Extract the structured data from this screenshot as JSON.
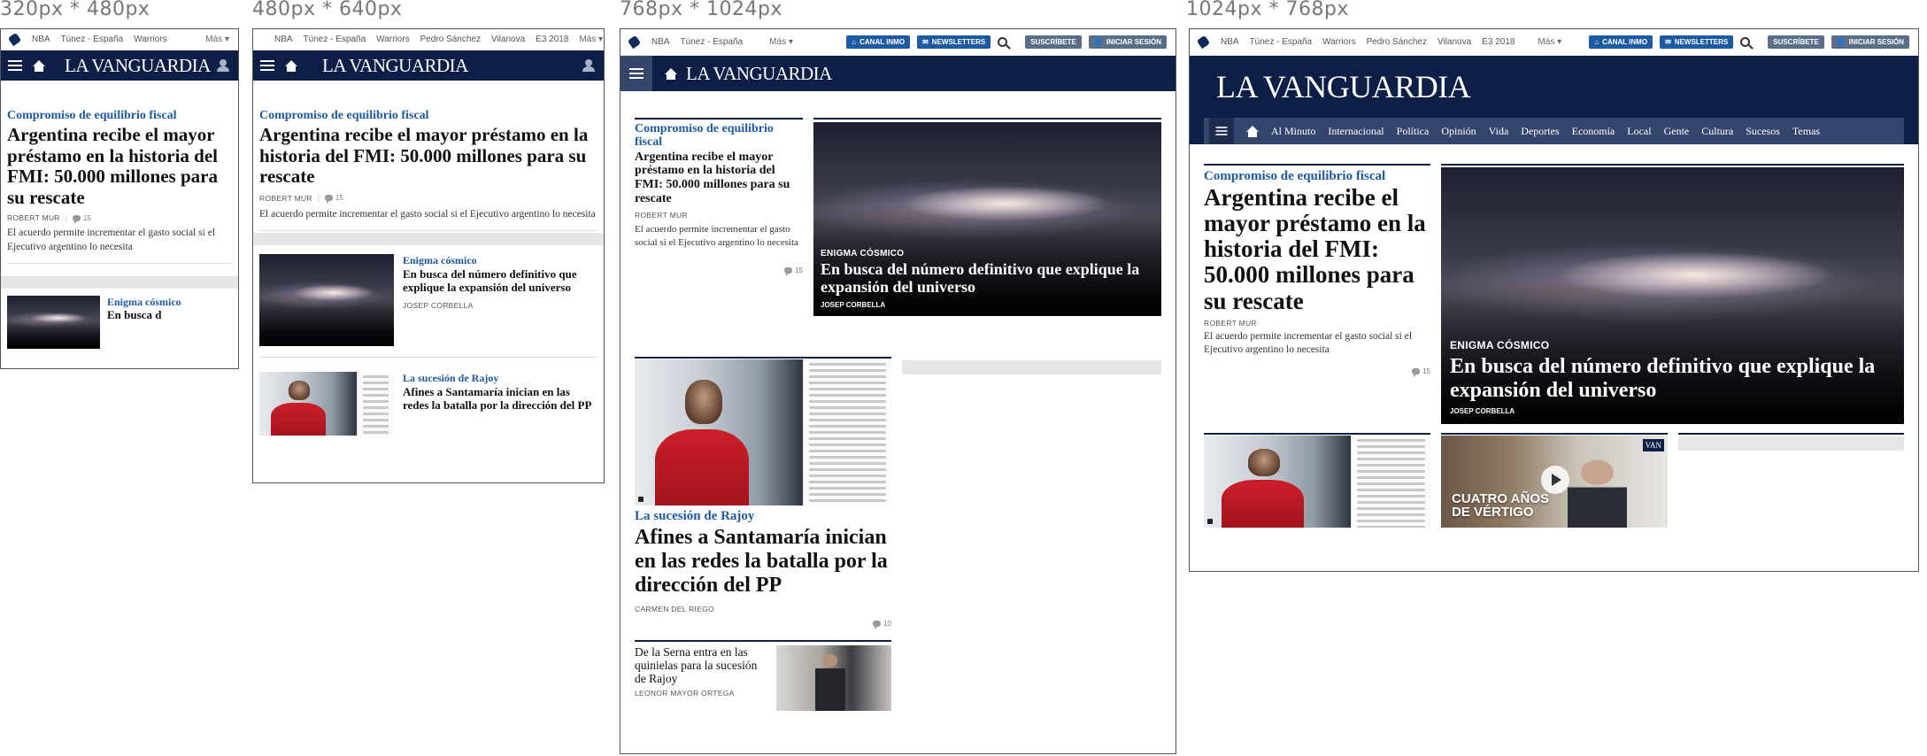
{
  "viewports": [
    "320px * 480px",
    "480px * 640px",
    "768px * 1024px",
    "1024px * 768px"
  ],
  "brand": {
    "logo": "LA VANGUARDIA",
    "navy": "#0e1f47",
    "accent_blue": "#1c5aa3"
  },
  "topbar": {
    "trending": [
      "NBA",
      "Túnez - España",
      "Warriors",
      "Pedro Sánchez",
      "Vilanova",
      "E3 2018"
    ],
    "more": "Más",
    "canal_inmo": "CANAL INMO",
    "newsletters": "NEWSLETTERS",
    "subscribe": "SUSCRÍBETE",
    "login": "INICIAR SESIÓN"
  },
  "nav_sections": [
    "Al Minuto",
    "Internacional",
    "Política",
    "Opinión",
    "Vida",
    "Deportes",
    "Economía",
    "Local",
    "Gente",
    "Cultura",
    "Sucesos",
    "Temas"
  ],
  "lead": {
    "kicker": "Compromiso de equilibrio fiscal",
    "headline": "Argentina recibe el mayor préstamo en la historia del FMI: 50.000 millones para su rescate",
    "byline": "ROBERT MUR",
    "comments": "15",
    "dek": "El acuerdo permite incrementar el gasto social si el Ejecutivo argentino lo necesita"
  },
  "galaxy": {
    "kicker": "Enigma cósmico",
    "kicker_upper": "ENIGMA CÓSMICO",
    "headline": "En busca del número definitivo que explique la expansión del universo",
    "byline": "JOSEP CORBELLA",
    "snippet": "En busca d"
  },
  "rajoy": {
    "kicker": "La sucesión de Rajoy",
    "headline": "Afines a Santamaría inician en las redes la batalla por la dirección del PP",
    "byline": "CARMEN DEL RIEGO",
    "comments": "10"
  },
  "serna": {
    "headline": "De la Serna entra en las quinielas para la sucesión de Rajoy",
    "byline": "LEONOR MAYOR ORTEGA"
  },
  "video": {
    "title": "CUATRO AÑOS DE VÉRTIGO",
    "badge": "VAN"
  }
}
